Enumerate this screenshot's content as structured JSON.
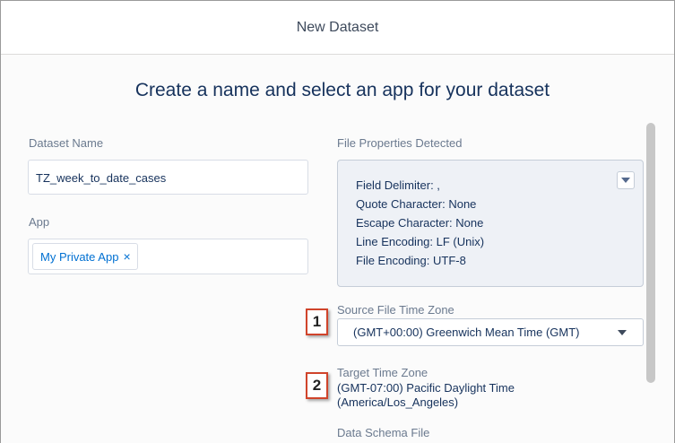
{
  "modal": {
    "title": "New Dataset"
  },
  "heading": "Create a name and select an app for your dataset",
  "dataset_name": {
    "label": "Dataset Name",
    "value": "TZ_week_to_date_cases"
  },
  "app": {
    "label": "App",
    "selected_pill": "My Private App",
    "remove_glyph": "×"
  },
  "file_properties": {
    "label": "File Properties Detected",
    "lines": [
      "Field Delimiter: ,",
      "Quote Character: None",
      "Escape Character: None",
      "Line Encoding: LF (Unix)",
      "File Encoding: UTF-8"
    ],
    "toggle_icon": "chevron-down-icon"
  },
  "source_time_zone": {
    "label": "Source File Time Zone",
    "value": "(GMT+00:00) Greenwich Mean Time (GMT)"
  },
  "target_time_zone": {
    "label": "Target Time Zone",
    "value_line1": "(GMT-07:00) Pacific Daylight Time",
    "value_line2": "(America/Los_Angeles)"
  },
  "data_schema": {
    "label": "Data Schema File"
  },
  "callouts": [
    "1",
    "2"
  ],
  "colors": {
    "accent": "#0070d2",
    "callout_border": "#d0442b",
    "heading": "#16325c"
  }
}
